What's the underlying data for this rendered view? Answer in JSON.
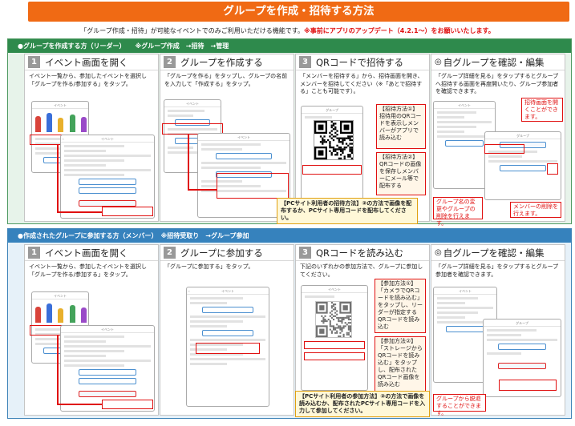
{
  "header": {
    "title": "グループを作成・招待する方法",
    "notice_main": "「グループ作成・招待」が可能なイベントでのみご利用いただける機能です。",
    "notice_red": "※事前にアプリのアップデート（4.2.1〜）をお願いいたします。"
  },
  "leader": {
    "heading": "●グループを作成する方（リーダー）　　※グループ作成　→招待　→管理",
    "steps": [
      {
        "num": "1",
        "title": "イベント画面を開く",
        "desc": "イベント一覧から、参加したイベントを選択し「グループを作る/参加する」をタップ。"
      },
      {
        "num": "2",
        "title": "グループを作成する",
        "desc": "「グループを作る」をタップし、グループの名前を入力して「作成する」をタップ。"
      },
      {
        "num": "3",
        "title": "QRコードで招待する",
        "desc": "「メンバーを招待する」から、招待画面を開き、メンバーを招待してください（※「あとで招待する」ことも可能です）。"
      },
      {
        "num": "◎",
        "title": "自グループを確認・編集",
        "desc": "「グループ詳細を見る」をタップするとグループへ招待する画面を再度開いたり、グループ参加者を確認できます。"
      }
    ],
    "callouts": {
      "invite1": "【招待方法①】招待用のQRコードを表示しメンバーがアプリで読み込む",
      "invite2": "【招待方法②】QRコードの画像を保存しメンバーにメール等で配布する",
      "pc_method": "【PCサイト利用者の招待方法】②の方法で画像を配布するか、PCサイト専用コードを配布してください。",
      "reopen": "招待画面を開くことができます。",
      "rename": "グループ名の変更やグループの削除を行えます。",
      "remove_member": "メンバーの削除を行えます。"
    }
  },
  "member": {
    "heading": "●作成されたグループに参加する方（メンバー）　※招待受取り　→グループ参加",
    "steps": [
      {
        "num": "1",
        "title": "イベント画面を開く",
        "desc": "イベント一覧から、参加したイベントを選択し「グループを作る/参加する」をタップ。"
      },
      {
        "num": "2",
        "title": "グループに参加する",
        "desc": "「グループに参加する」をタップ。"
      },
      {
        "num": "3",
        "title": "QRコードを読み込む",
        "desc": "下記のいずれかの参加方法で、グループに参加してください。"
      },
      {
        "num": "◎",
        "title": "自グループを確認・編集",
        "desc": "「グループ詳細を見る」をタップするとグループ参加者を確認できます。"
      }
    ],
    "callouts": {
      "join1": "【参加方法①】「カメラでQRコードを読み込む」をタップし、リーダーが指定するQRコードを読み込む",
      "join2": "【参加方法②】「ストレージからQRコードを読み込む」をタップし、配布されたQRコード画像を読み込む",
      "pc_method": "【PCサイト利用者の参加方法】②の方法で画像を読み込むか、配布されたPCサイト専用コードを入力して参加してください。",
      "leave": "グループから脱退することができます。"
    }
  },
  "icons": {
    "settings": "gear-icon",
    "back": "chevron-left-icon"
  },
  "colors": {
    "accent": "#f06a14",
    "leader": "#2e8a4c",
    "member": "#3682bd",
    "highlight": "#e01010"
  }
}
